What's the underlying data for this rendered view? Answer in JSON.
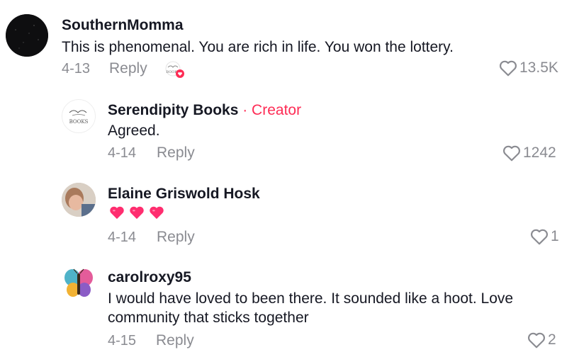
{
  "comments": [
    {
      "username": "SouthernMomma",
      "text": "This is phenomenal. You are rich in life. You won the lottery.",
      "date": "4-13",
      "reply_label": "Reply",
      "likes": "13.5K"
    },
    {
      "username": "Serendipity Books",
      "creator_badge": " · Creator",
      "text": "Agreed.",
      "date": "4-14",
      "reply_label": "Reply",
      "likes": "1242",
      "avatar_text": "BOOKS"
    },
    {
      "username": "Elaine Griswold Hosk",
      "text": "",
      "emojis": [
        "heart-emoji",
        "heart-emoji",
        "heart-emoji"
      ],
      "date": "4-14",
      "reply_label": "Reply",
      "likes": "1"
    },
    {
      "username": "carolroxy95",
      "text": "I would have loved to been there. It sounded like a hoot. Love community that sticks together",
      "date": "4-15",
      "reply_label": "Reply",
      "likes": "2"
    }
  ],
  "colors": {
    "creator": "#fe2c55",
    "muted": "#8a8b91",
    "heart_emoji": "#ff2d6f"
  }
}
